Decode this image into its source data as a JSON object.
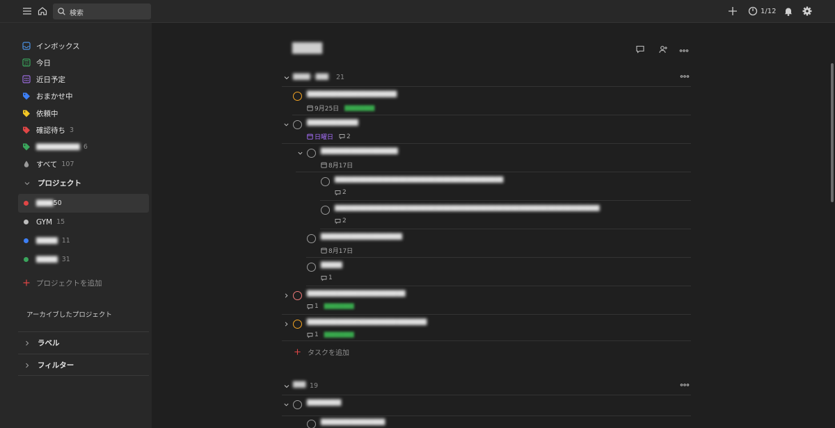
{
  "topbar": {
    "search_placeholder": "検索",
    "karma": "1/12",
    "icons": [
      "menu-icon",
      "home-icon",
      "search-icon",
      "plus-icon",
      "productivity-icon",
      "bell-icon",
      "gear-icon"
    ]
  },
  "sidebar": {
    "nav": [
      {
        "label": "インボックス",
        "icon": "inbox-icon",
        "color": "#4a90e2",
        "count": ""
      },
      {
        "label": "今日",
        "icon": "today-icon",
        "color": "#3aa55c",
        "count": ""
      },
      {
        "label": "近日予定",
        "icon": "upcoming-icon",
        "color": "#9a6bdc",
        "count": ""
      },
      {
        "label": "おまかせ中",
        "icon": "tag-icon",
        "color": "#3d7ff5",
        "count": ""
      },
      {
        "label": "依頼中",
        "icon": "tag-icon",
        "color": "#f2c624",
        "count": ""
      },
      {
        "label": "確認待ち",
        "icon": "tag-icon",
        "color": "#e04646",
        "count": "3"
      },
      {
        "label": "████████████",
        "icon": "tag-icon",
        "color": "#3aa55c",
        "count": "6"
      },
      {
        "label": "すべて",
        "icon": "drop-icon",
        "color": "#9a9a9a",
        "count": "107"
      }
    ],
    "projects_header": "プロジェクト",
    "projects": [
      {
        "label": "████",
        "count": "50",
        "color": "#e04646"
      },
      {
        "label": "GYM",
        "count": "15",
        "color": "#bdbdbd"
      },
      {
        "label": "█████",
        "count": "11",
        "color": "#3d7ff5"
      },
      {
        "label": "█████",
        "count": "31",
        "color": "#3aa55c"
      }
    ],
    "add_project": "プロジェクトを追加",
    "archived": "アーカイブしたプロジェクト",
    "labels_header": "ラベル",
    "filters_header": "フィルター"
  },
  "main": {
    "title": "████",
    "sections": [
      {
        "name": "████・███",
        "count": "21"
      },
      {
        "name": "███",
        "count": "19"
      }
    ],
    "tasks": [
      {
        "title": "█████████████████████",
        "date": "9月25日",
        "extra": "████████",
        "comments": "",
        "priority": "p2"
      },
      {
        "title": "████████████",
        "date": "日曜日",
        "extra": "",
        "comments": "2",
        "priority": "p4"
      },
      {
        "title": "██████████████████",
        "date": "8月17日",
        "extra": "",
        "comments": "",
        "priority": "p4"
      },
      {
        "title": "██████████████████████████████████████████",
        "date": "",
        "extra": "",
        "comments": "2",
        "priority": "p4"
      },
      {
        "title": "██████████████████████████████████████████████████████████████████",
        "date": "",
        "extra": "",
        "comments": "2",
        "priority": "p4"
      },
      {
        "title": "███████████████████",
        "date": "8月17日",
        "extra": "",
        "comments": "",
        "priority": "p4"
      },
      {
        "title": "█████",
        "date": "",
        "extra": "",
        "comments": "1",
        "priority": "p4"
      },
      {
        "title": "███████████████████████",
        "date": "",
        "extra": "████████",
        "comments": "1",
        "priority": "p1"
      },
      {
        "title": "████████████████████████████",
        "date": "",
        "extra": "████████",
        "comments": "1",
        "priority": "p2"
      },
      {
        "title": "████████",
        "date": "",
        "extra": "",
        "comments": "",
        "priority": "p4"
      },
      {
        "title": "███████████████",
        "date": "",
        "extra": "",
        "comments": "",
        "priority": "p4"
      }
    ],
    "add_task": "タスクを追加"
  }
}
